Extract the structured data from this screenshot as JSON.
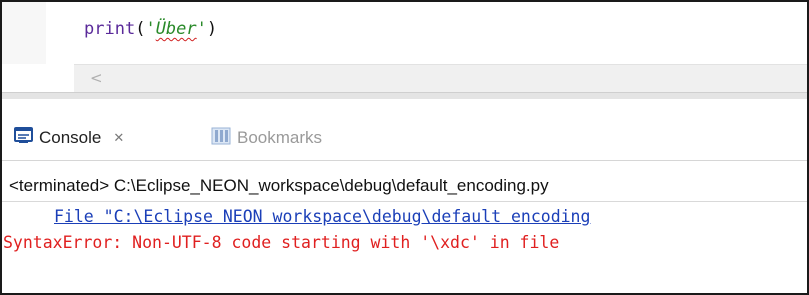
{
  "editor": {
    "code": {
      "fn": "print",
      "open": "(",
      "quote_open": "'",
      "str": "Über",
      "quote_close": "'",
      "close": ")"
    },
    "scroll_left": "<"
  },
  "tabs": {
    "console_label": "Console",
    "console_close": "✕",
    "bookmarks_label": "Bookmarks"
  },
  "console": {
    "status": "<terminated> C:\\Eclipse_NEON_workspace\\debug\\default_encoding.py",
    "trace_line": "File \"C:\\Eclipse NEON workspace\\debug\\default encoding",
    "error_line": "SyntaxError: Non-UTF-8 code starting with '\\xdc' in file"
  },
  "colors": {
    "link": "#1b3fb8",
    "error": "#e02020",
    "string": "#2a8a2a",
    "keyword": "#5a2a9a",
    "console_icon": "#1f4e9a"
  }
}
